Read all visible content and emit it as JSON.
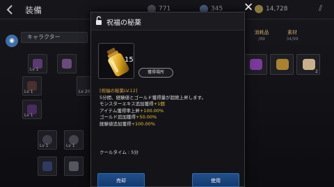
{
  "header": {
    "title": "装備",
    "resources": [
      {
        "icon": "crystal-icon",
        "value": "771"
      },
      {
        "icon": "gem-icon",
        "value": "345"
      },
      {
        "icon": "gold-coin-icon",
        "value": "14,728"
      }
    ]
  },
  "left_panel": {
    "tab_label": "キャラクター",
    "slots": [
      {
        "level": "Lv 1"
      },
      {
        "level": "Lv 1"
      },
      {
        "level": "Lv 20"
      },
      {
        "level": "Lv 1"
      },
      {
        "level": "Lv 1"
      },
      {
        "level": "Lv 1"
      }
    ]
  },
  "right_panel": {
    "tabs": [
      {
        "label": "消耗品",
        "count": "/99"
      },
      {
        "label": "素材",
        "count": "34/99"
      }
    ],
    "items": [
      {
        "count": "2"
      },
      {
        "count": ""
      },
      {
        "count": ""
      }
    ]
  },
  "modal": {
    "title": "祝福の秘薬",
    "quantity": "15",
    "source_button": "獲得場所",
    "item_name_line": "[祝福の秘薬LV.12]",
    "desc_lines": [
      {
        "text": "5分間、経験値とゴールド獲得量が超絶上昇します。",
        "value": ""
      },
      {
        "text": "モンスターエキス追加獲得",
        "value": "+1個"
      },
      {
        "text": "アイテム獲得率上昇",
        "value": "+100.00%"
      },
      {
        "text": "ゴールド追加獲得",
        "value": "+50.00%"
      },
      {
        "text": "経験値追加獲得",
        "value": "+100.00%"
      }
    ],
    "cooldown": "クールタイム : 5分",
    "sell_button": "売却",
    "use_button": "使用"
  },
  "colors": {
    "accent_gold": "#d9a640",
    "value_yellow": "#e9c33a",
    "button_blue": "#1f4f8c"
  }
}
